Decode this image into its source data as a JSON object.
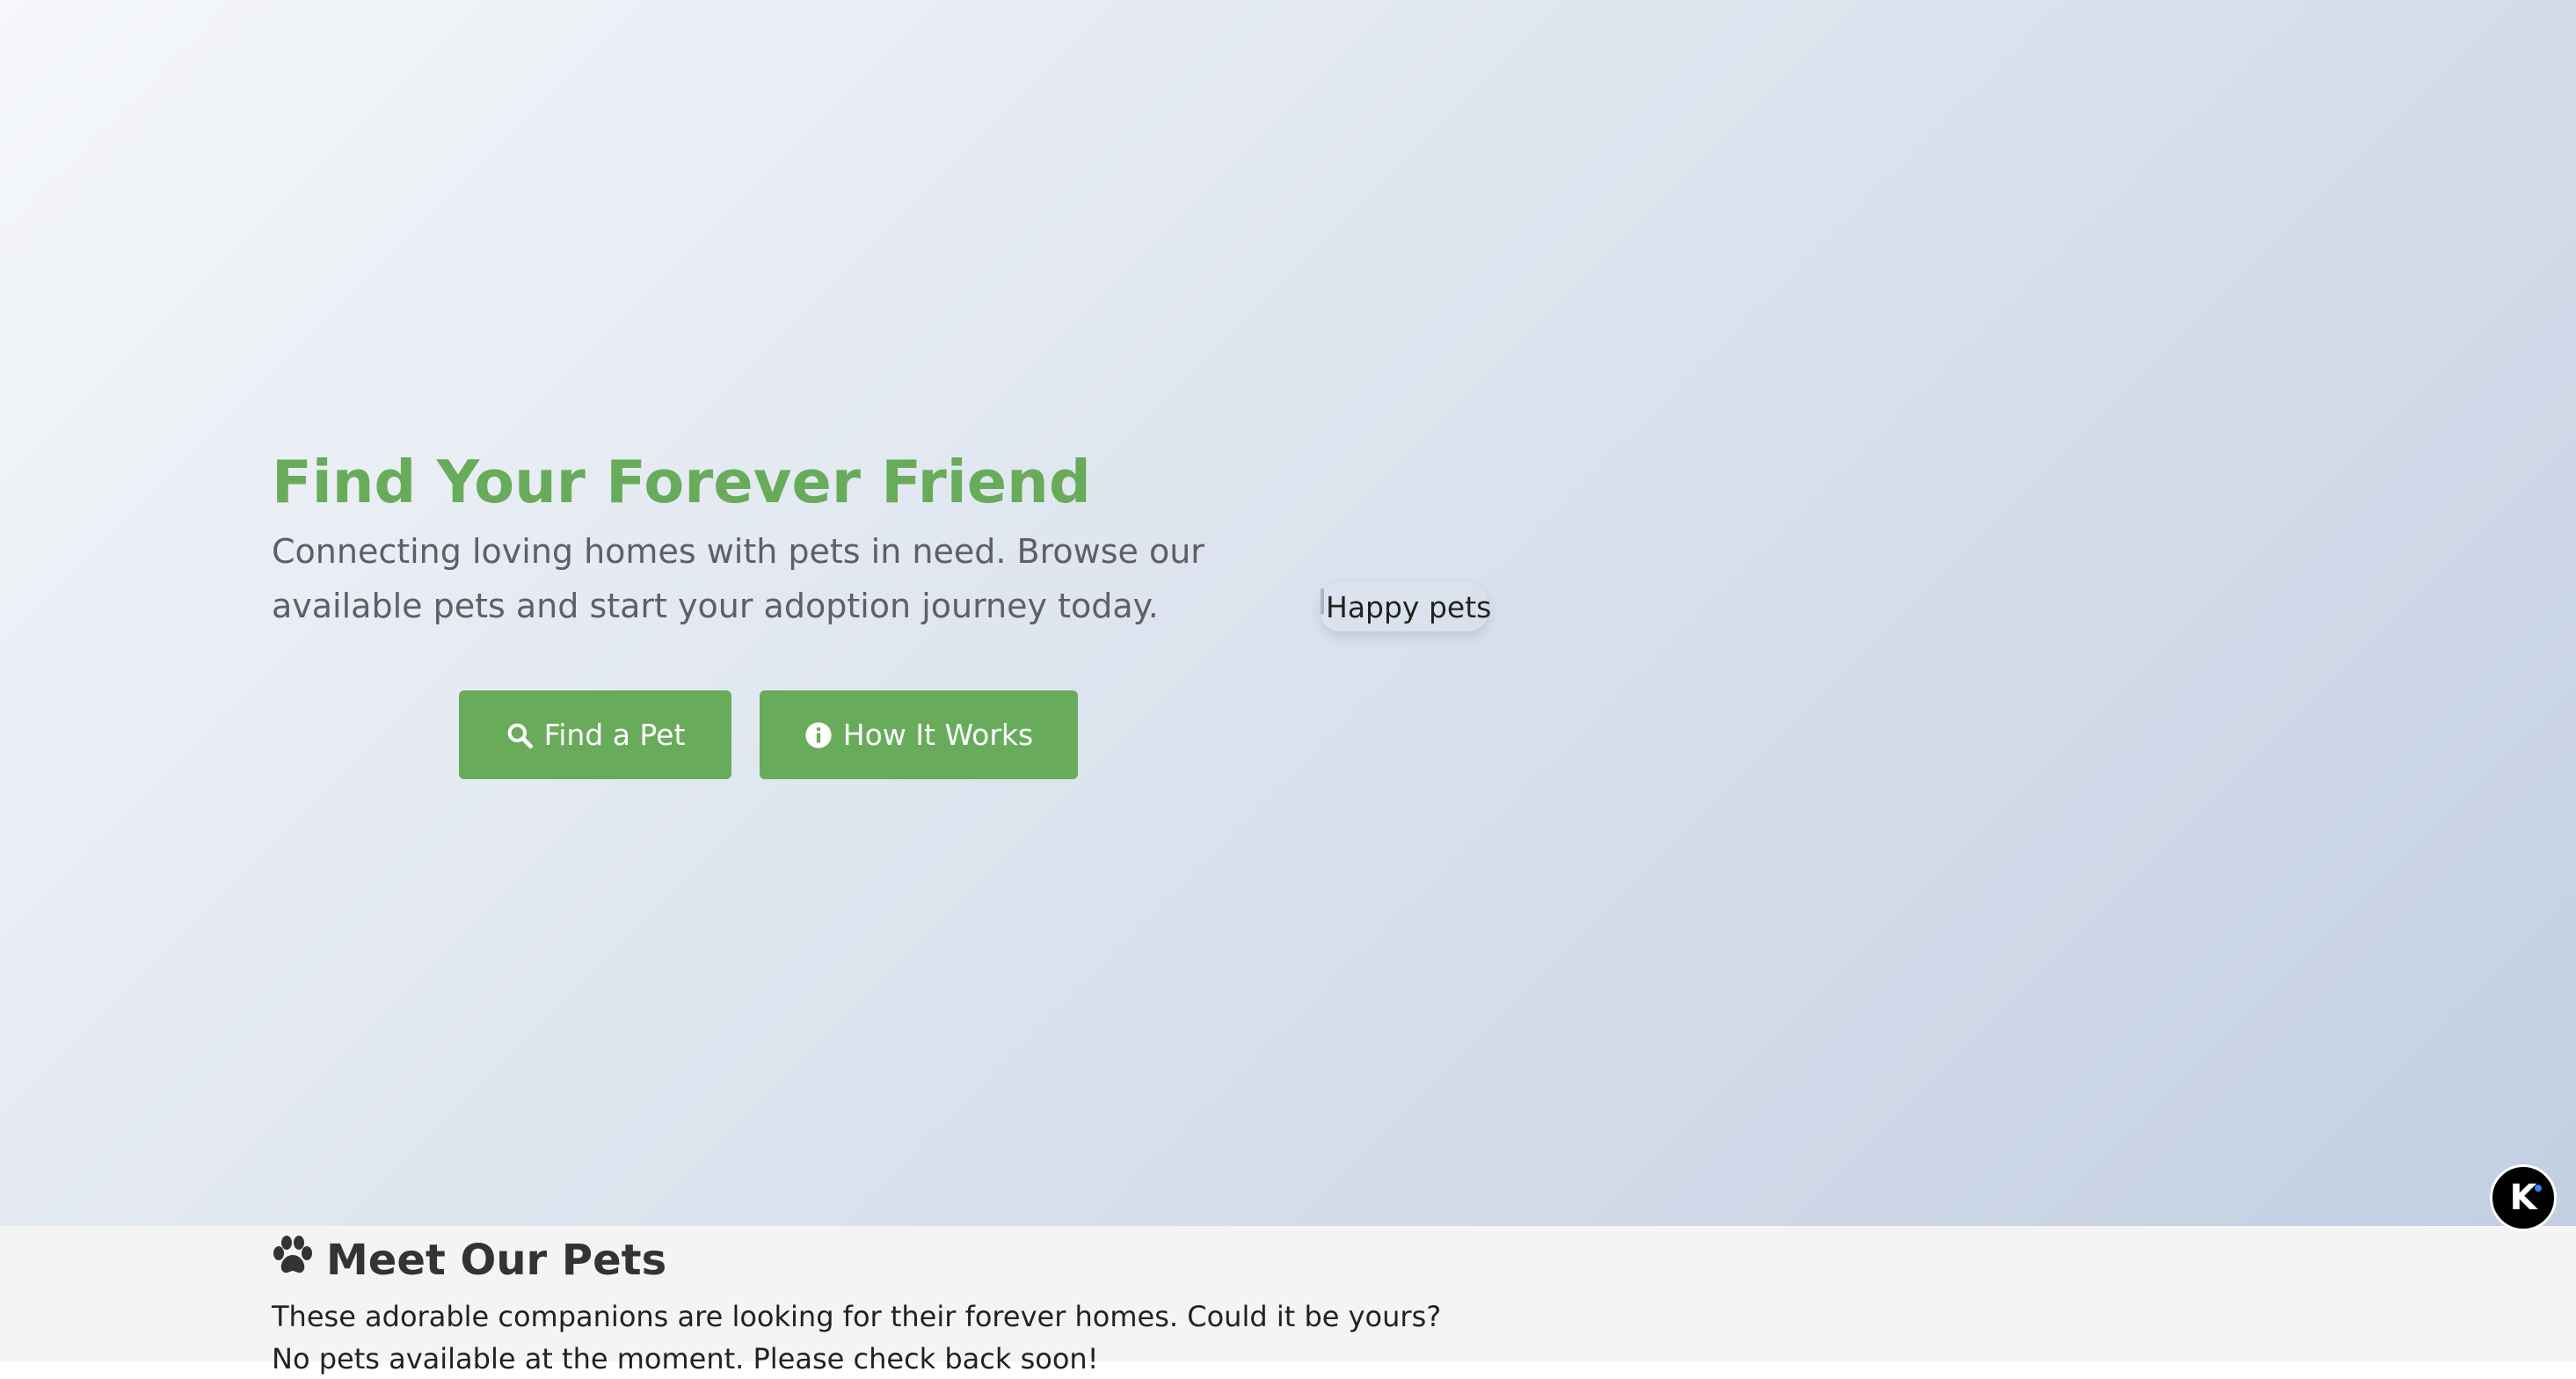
{
  "hero": {
    "title": "Find Your Forever Friend",
    "subtitle": "Connecting loving homes with pets in need. Browse our available pets and start your adoption journey today.",
    "image_alt": "Happy pets",
    "buttons": {
      "find_label": "Find a Pet",
      "find_icon": "search-icon",
      "how_label": "How It Works",
      "how_icon": "info-icon"
    },
    "accent_color": "#68ac5b"
  },
  "pets": {
    "title": "Meet Our Pets",
    "title_icon": "paw-icon",
    "description": "These adorable companions are looking for their forever homes. Could it be yours?",
    "empty_message": "No pets available at the moment. Please check back soon!"
  },
  "fab": {
    "label": "K"
  }
}
